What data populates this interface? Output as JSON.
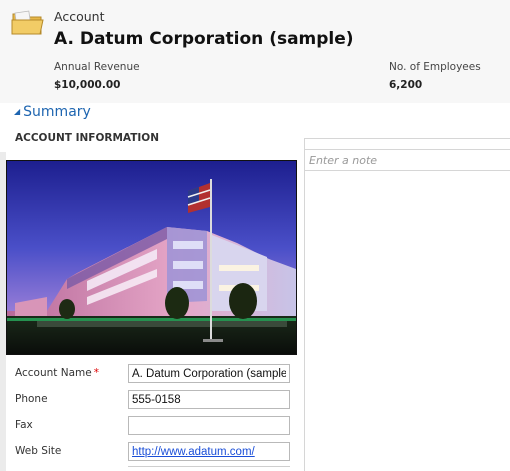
{
  "header": {
    "entity_type": "Account",
    "title": "A. Datum Corporation (sample)",
    "fields": [
      {
        "label": "Annual Revenue",
        "value": "$10,000.00"
      },
      {
        "label": "No. of Employees",
        "value": "6,200"
      }
    ]
  },
  "icons": {
    "entity_icon": "folder-icon",
    "summary_toggle_icon": "collapse-triangle-icon"
  },
  "summary": {
    "label": "Summary"
  },
  "section": {
    "heading": "ACCOUNT INFORMATION"
  },
  "notes": {
    "placeholder": "Enter a note"
  },
  "form": {
    "fields": [
      {
        "label": "Account Name",
        "required": true,
        "value": "A. Datum Corporation (sample)"
      },
      {
        "label": "Phone",
        "required": false,
        "value": "555-0158"
      },
      {
        "label": "Fax",
        "required": false,
        "value": ""
      },
      {
        "label": "Web Site",
        "required": false,
        "value": "http://www.adatum.com/"
      }
    ],
    "required_marker": "*"
  },
  "colors": {
    "link": "#1e65b0",
    "required": "#dd0000",
    "header_bg": "#f7f7f7"
  }
}
